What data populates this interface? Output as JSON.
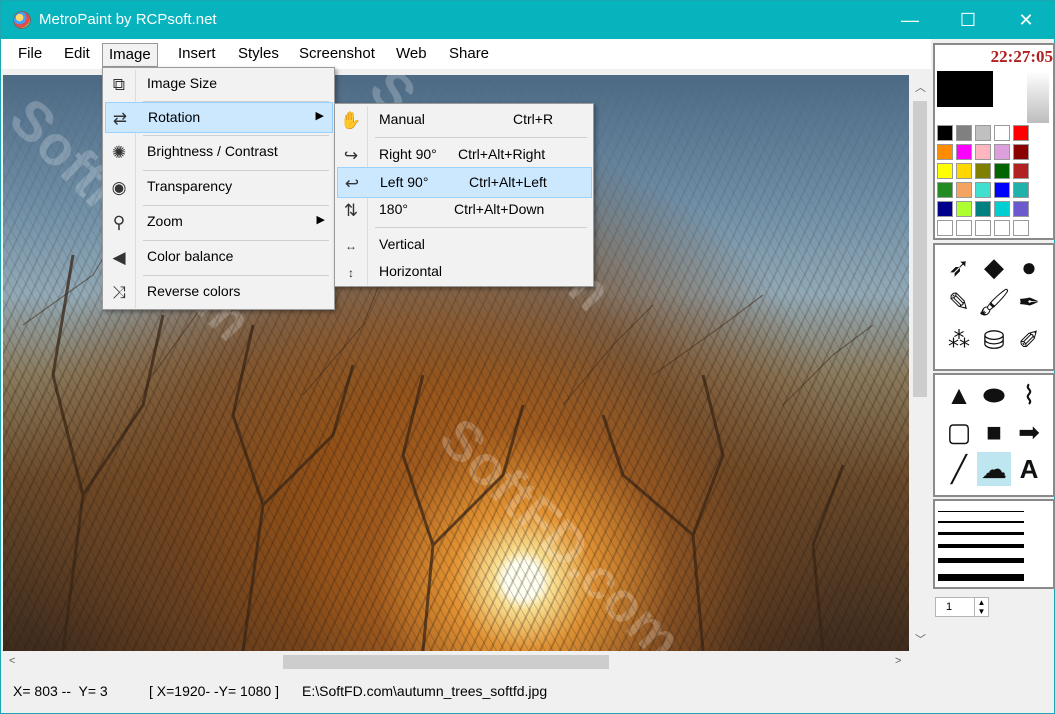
{
  "window": {
    "title": "MetroPaint by RCPsoft.net"
  },
  "window_controls": {
    "minimize": "—",
    "maximize": "☐",
    "close": "✕"
  },
  "menubar": {
    "items": [
      "File",
      "Edit",
      "Image",
      "Insert",
      "Styles",
      "Screenshot",
      "Web",
      "Share"
    ],
    "active": "Image"
  },
  "image_menu": {
    "items": [
      {
        "label": "Image Size",
        "icon": "resize-icon"
      },
      {
        "label": "Rotation",
        "icon": "rotate-icon",
        "submenu": true,
        "highlighted": true
      },
      {
        "label": "Brightness / Contrast",
        "icon": "sun-icon"
      },
      {
        "label": "Transparency",
        "icon": "eye-icon"
      },
      {
        "label": "Zoom",
        "icon": "magnifier-icon",
        "submenu": true
      },
      {
        "label": "Color balance",
        "icon": "balance-icon"
      },
      {
        "label": "Reverse colors",
        "icon": "shuffle-icon"
      }
    ]
  },
  "rotation_menu": {
    "items": [
      {
        "label": "Manual",
        "shortcut": "Ctrl+R",
        "icon": "hand-icon"
      },
      {
        "label": "Right 90°",
        "shortcut": "Ctrl+Alt+Right",
        "icon": "turn-right-icon"
      },
      {
        "label": "Left 90°",
        "shortcut": "Ctrl+Alt+Left",
        "icon": "turn-left-icon",
        "highlighted": true
      },
      {
        "label": "180°",
        "shortcut": "Ctrl+Alt+Down",
        "icon": "flip-180-icon"
      },
      {
        "label": "Vertical",
        "shortcut": "",
        "icon": "vertical-flip-icon"
      },
      {
        "label": "Horizontal",
        "shortcut": "",
        "icon": "horizontal-flip-icon"
      }
    ]
  },
  "side_panel": {
    "clock": "22:27:05",
    "primary_color": "#000000",
    "secondary_color": "#ffffff",
    "palette": [
      [
        "#000000",
        "#808080",
        "#c0c0c0",
        "#ffffff",
        "#ff0000"
      ],
      [
        "#ff8c00",
        "#ff00ff",
        "#ffb6c1",
        "#dda0dd",
        "#8b0000"
      ],
      [
        "#ffff00",
        "#ffd700",
        "#808000",
        "#006400",
        "#b22222"
      ],
      [
        "#228b22",
        "#f4a460",
        "#40e0d0",
        "#0000ff",
        "#20b2aa"
      ],
      [
        "#00008b",
        "#adff2f",
        "#008080",
        "#00ced1",
        "#6a5acd"
      ],
      [
        "#ffffff",
        "#ffffff",
        "#ffffff",
        "#ffffff",
        "#ffffff"
      ]
    ],
    "tools": [
      "pointer-tool-icon",
      "eraser-tool-icon",
      "drop-tool-icon",
      "pencil-tool-icon",
      "brush-tool-icon",
      "dropper-tool-icon",
      "spray-tool-icon",
      "fill-tool-icon",
      "highlighter-tool-icon"
    ],
    "shapes": [
      "triangle-shape-icon",
      "ellipse-shape-icon",
      "polyline-shape-icon",
      "rectangle-shape-icon",
      "rounded-rect-shape-icon",
      "arrow-shape-icon",
      "line-shape-icon",
      "cloud-shape-icon",
      "text-tool-icon"
    ],
    "text_tool_label": "A",
    "line_width": "1"
  },
  "status": {
    "cursor": "X= 803 --  Y= 3",
    "image_size": "[ X=1920- -Y= 1080 ]",
    "file_path": "E:\\SoftFD.com\\autumn_trees_softfd.jpg"
  },
  "watermark": "SoftFD.com"
}
